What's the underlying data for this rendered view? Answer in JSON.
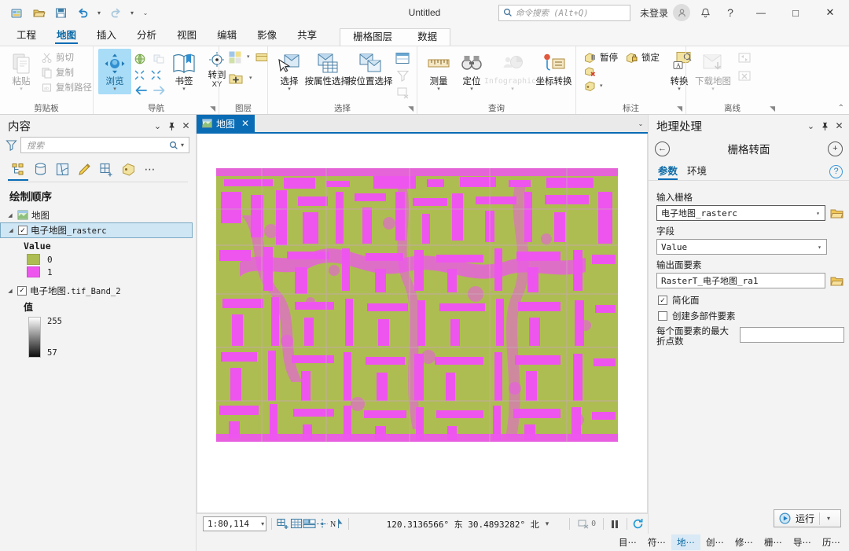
{
  "titlebar": {
    "project_title": "Untitled",
    "search_placeholder": "命令搜索 (Alt+Q)",
    "account_label": "未登录",
    "quick_access": [
      "new-project-icon",
      "open-project-icon",
      "save-project-icon",
      "undo-icon",
      "redo-icon",
      "customize-qat-icon"
    ],
    "window_buttons": {
      "minimize": "—",
      "maximize": "□",
      "close": "✕"
    }
  },
  "ribbon": {
    "tabs": [
      {
        "label": "工程",
        "active": false
      },
      {
        "label": "地图",
        "active": true
      },
      {
        "label": "插入",
        "active": false
      },
      {
        "label": "分析",
        "active": false
      },
      {
        "label": "视图",
        "active": false
      },
      {
        "label": "编辑",
        "active": false
      },
      {
        "label": "影像",
        "active": false
      },
      {
        "label": "共享",
        "active": false
      }
    ],
    "contextual_tabs": [
      {
        "label": "栅格图层"
      },
      {
        "label": "数据"
      }
    ],
    "groups": [
      {
        "title": "剪贴板",
        "big": [
          {
            "label": "粘贴",
            "icon": "paste-icon",
            "dropdown": true,
            "disabled": true
          }
        ],
        "small": [
          {
            "label": "剪切",
            "icon": "cut-icon",
            "disabled": true
          },
          {
            "label": "复制",
            "icon": "copy-icon",
            "disabled": true
          },
          {
            "label": "复制路径",
            "icon": "copy-path-icon",
            "disabled": true
          }
        ]
      },
      {
        "title": "导航",
        "big": [
          {
            "label": "浏览",
            "icon": "explore-icon",
            "dropdown": true,
            "selected": true
          },
          {
            "label": "书签",
            "icon": "bookmarks-icon",
            "dropdown": true
          },
          {
            "label": "转到",
            "label2": "XY",
            "icon": "go-to-xy-icon"
          }
        ],
        "dialog_launcher": true
      },
      {
        "title": "图层",
        "small": [
          {
            "label": "",
            "icon": "basemap-icon"
          },
          {
            "label": "",
            "icon": "add-data-icon"
          }
        ]
      },
      {
        "title": "选择",
        "big": [
          {
            "label": "选择",
            "icon": "select-icon",
            "dropdown": true
          },
          {
            "label": "按属性选择",
            "icon": "select-by-attributes-icon"
          },
          {
            "label": "按位置选择",
            "icon": "select-by-location-icon"
          }
        ],
        "dialog_launcher": true
      },
      {
        "title": "查询",
        "big": [
          {
            "label": "测量",
            "icon": "measure-icon",
            "dropdown": true
          },
          {
            "label": "定位",
            "icon": "locate-icon",
            "dropdown": true
          },
          {
            "label": "Infographics",
            "icon": "infographics-icon",
            "dropdown": true,
            "disabled": true
          },
          {
            "label": "坐标转换",
            "icon": "coordinate-conversion-icon"
          }
        ]
      },
      {
        "title": "标注",
        "small": [
          {
            "label": "暂停",
            "icon": "pause-labeling-icon"
          },
          {
            "label": "锁定",
            "icon": "lock-labels-icon"
          },
          {
            "label": "",
            "icon": "remove-labels-icon"
          },
          {
            "label": "",
            "icon": "label-style-icon"
          }
        ],
        "big": [
          {
            "label": "转换",
            "icon": "convert-labels-icon",
            "dropdown": true
          }
        ],
        "dialog_launcher": true
      },
      {
        "title": "离线",
        "big": [
          {
            "label": "下载地图",
            "icon": "download-map-icon",
            "dropdown": true,
            "disabled": true
          }
        ],
        "small": [
          {
            "label": "",
            "icon": "sync-icon",
            "disabled": true
          },
          {
            "label": "",
            "icon": "remove-offline-icon",
            "disabled": true
          }
        ],
        "dialog_launcher": true
      }
    ]
  },
  "contents": {
    "title": "内容",
    "search_placeholder": "搜索",
    "tools": [
      {
        "icon": "list-by-drawing-order-icon",
        "active": true
      },
      {
        "icon": "list-by-data-source-icon",
        "active": false
      },
      {
        "icon": "list-by-selection-icon",
        "active": false
      },
      {
        "icon": "list-by-editing-icon",
        "active": false
      },
      {
        "icon": "list-by-snapping-icon",
        "active": false
      },
      {
        "icon": "list-by-labeling-icon",
        "active": false
      },
      {
        "icon": "more-options-icon",
        "active": false
      }
    ],
    "section_header": "绘制顺序",
    "map_node": "地图",
    "layers": [
      {
        "name": "电子地图_rasterc",
        "checked": true,
        "selected": true,
        "legend_title": "Value",
        "legend_kind": "unique",
        "legend_items": [
          {
            "value": "0",
            "color": "#aebd51"
          },
          {
            "value": "1",
            "color": "#ee55ee"
          }
        ]
      },
      {
        "name": "电子地图.tif_Band_2",
        "checked": true,
        "selected": false,
        "legend_title": "值",
        "legend_kind": "ramp",
        "ramp_high": "255",
        "ramp_low": "57",
        "ramp_from": "#ffffff",
        "ramp_to": "#0d0d0d"
      }
    ]
  },
  "map": {
    "tab_label": "地图",
    "tab_close": "✕",
    "raster_colors": {
      "class0": "#aebd51",
      "class1": "#ee55ee"
    }
  },
  "statusbar": {
    "scale": "1:80,114",
    "coordinates_text": "120.3136566° 东  30.4893282° 北",
    "selection_count": "0",
    "tools": [
      {
        "icon": "fixed-zoom-in-icon"
      },
      {
        "icon": "grid-icon"
      },
      {
        "icon": "map-scale-icon"
      },
      {
        "icon": "snapping-icon"
      },
      {
        "icon": "north-arrow-icon"
      }
    ],
    "pause_label": "pause-drawing-icon",
    "refresh_label": "refresh-icon"
  },
  "geoprocessing": {
    "title": "地理处理",
    "tool_name": "栅格转面",
    "back_icon": "back-arrow-icon",
    "add_icon": "add-icon",
    "tabs": [
      {
        "label": "参数",
        "active": true
      },
      {
        "label": "环境",
        "active": false
      }
    ],
    "help_icon": "help-icon",
    "fields": [
      {
        "label": "输入栅格",
        "value": "电子地图_rasterc",
        "type": "combo-browse",
        "focused": true
      },
      {
        "label": "字段",
        "value": "Value",
        "type": "combo"
      },
      {
        "label": "输出面要素",
        "value": "RasterT_电子地图_ra1",
        "type": "text-browse"
      }
    ],
    "checkboxes": [
      {
        "label": "简化面",
        "checked": true
      },
      {
        "label": "创建多部件要素",
        "checked": false
      }
    ],
    "number_field": {
      "label": "每个面要素的最大折点数",
      "value": ""
    },
    "run_button": {
      "label": "运行",
      "icon": "run-play-icon"
    }
  },
  "dock_tabs": [
    {
      "label": "目⋯",
      "active": false
    },
    {
      "label": "符⋯",
      "active": false
    },
    {
      "label": "地⋯",
      "active": true
    },
    {
      "label": "创⋯",
      "active": false
    },
    {
      "label": "修⋯",
      "active": false
    },
    {
      "label": "栅⋯",
      "active": false
    },
    {
      "label": "导⋯",
      "active": false
    },
    {
      "label": "历⋯",
      "active": false
    }
  ]
}
